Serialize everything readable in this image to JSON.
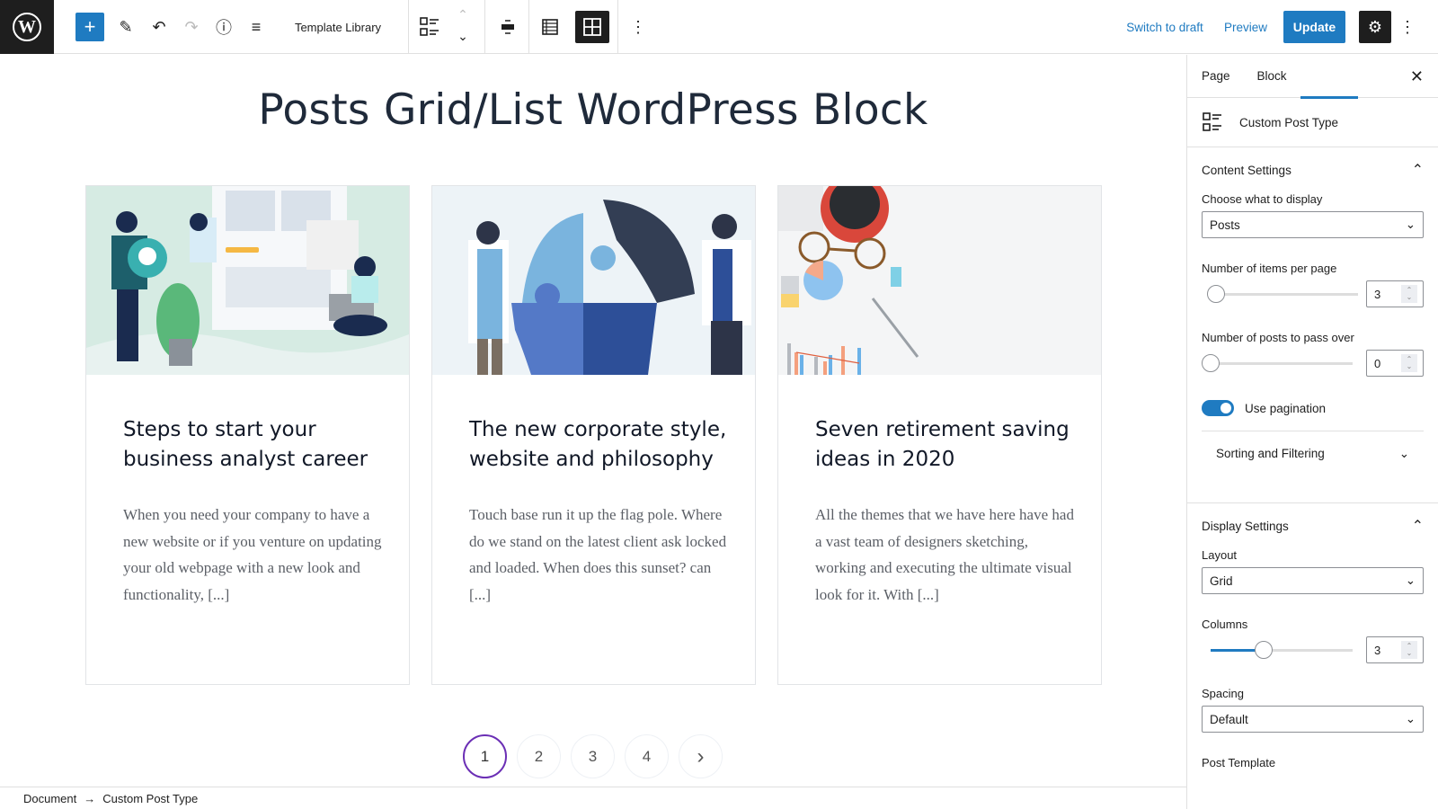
{
  "toolbar": {
    "logo": "W",
    "add_icon": "+",
    "edit_icon": "✎",
    "undo_icon": "↶",
    "redo_icon": "↷",
    "info_icon": "ⓘ",
    "outline_icon": "≡",
    "template_library": "Template Library",
    "move_up_icon": "⌃",
    "move_down_icon": "⌄",
    "align_icon": "⊟",
    "list_view_icon": "▤",
    "grid_view_icon": "⊞",
    "more_icon": "⋮",
    "switch_to_draft": "Switch to draft",
    "preview": "Preview",
    "update": "Update",
    "settings_icon": "⚙",
    "options_icon": "⋮"
  },
  "page": {
    "title": "Posts Grid/List WordPress Block"
  },
  "posts": [
    {
      "title": "Steps to start your business analyst career",
      "excerpt": "When you need your company to have a new website or if you venture on updating your old webpage with a new look and functionality, [...]"
    },
    {
      "title": "The new corporate style, website and philosophy",
      "excerpt": "Touch base run it up the flag pole. Where do we stand on the latest client ask locked and loaded. When does this sunset? can [...]"
    },
    {
      "title": "Seven retirement saving ideas in 2020",
      "excerpt": "All the themes that we have here have had a vast team of designers sketching, working and executing the ultimate visual look for it. With [...]"
    }
  ],
  "pagination": {
    "pages": [
      "1",
      "2",
      "3",
      "4"
    ],
    "current": "1",
    "next_icon": "›",
    "active_color": "#6b2fb5"
  },
  "footer": {
    "breadcrumb": [
      "Document",
      "Custom Post Type"
    ],
    "separator": "→"
  },
  "sidebar": {
    "tabs": [
      "Page",
      "Block"
    ],
    "active_tab": "Block",
    "close_icon": "✕",
    "block_name": "Custom Post Type",
    "content_settings": {
      "title": "Content Settings",
      "display_label": "Choose what to display",
      "display_value": "Posts",
      "items_label": "Number of items per page",
      "items_value": "3",
      "items_fraction": 0.0,
      "offset_label": "Number of posts to pass over",
      "offset_value": "0",
      "offset_fraction": 0.0,
      "pagination_label": "Use pagination",
      "pagination_enabled": true,
      "sorting_label": "Sorting and Filtering"
    },
    "display_settings": {
      "title": "Display Settings",
      "layout_label": "Layout",
      "layout_value": "Grid",
      "columns_label": "Columns",
      "columns_value": "3",
      "columns_fraction": 0.4,
      "spacing_label": "Spacing",
      "spacing_value": "Default",
      "next_label": "Post Template"
    },
    "chevron_up": "⌃",
    "chevron_down": "⌄"
  },
  "colors": {
    "accent": "#1f7bc1",
    "dark": "#1e1e1e"
  }
}
